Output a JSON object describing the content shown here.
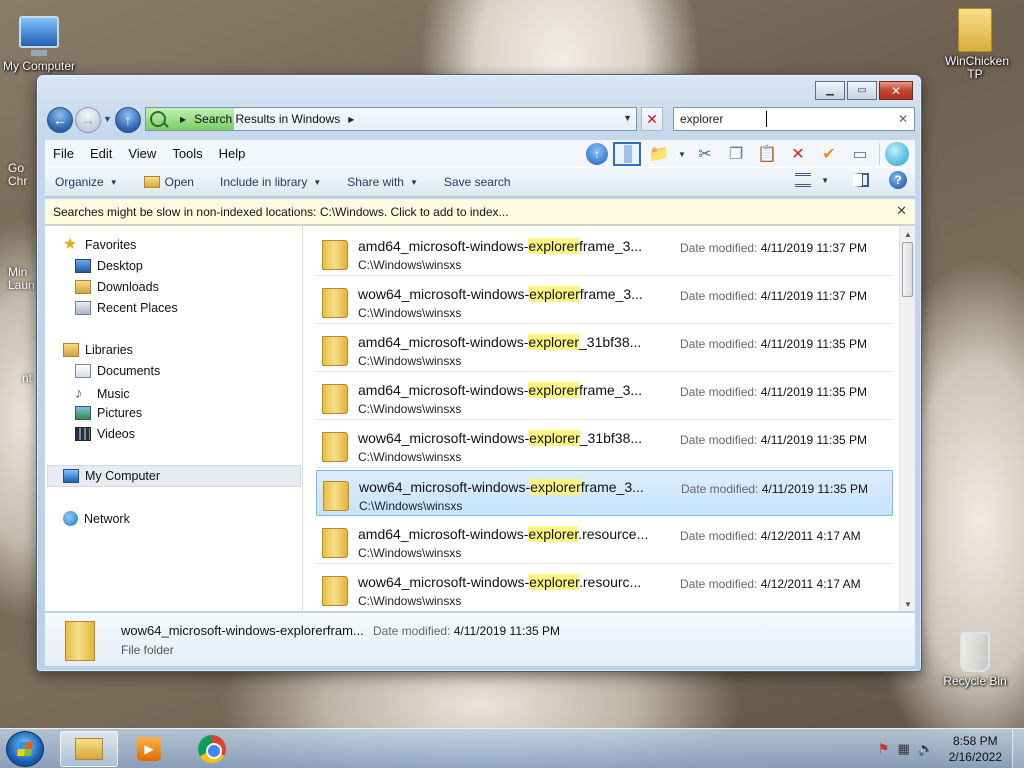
{
  "desktop": {
    "icons": {
      "my_computer": "My Computer",
      "winchicken": "WinChicken TP",
      "recycle_bin": "Recycle Bin",
      "partial_chrome": "Go\nChr",
      "partial_minecraft": "Min\nLaun",
      "partial_nt": "nt"
    }
  },
  "window": {
    "address": {
      "breadcrumb": "Search Results in Windows"
    },
    "search": {
      "value": "explorer"
    },
    "menu": [
      "File",
      "Edit",
      "View",
      "Tools",
      "Help"
    ],
    "commands": {
      "organize": "Organize",
      "open": "Open",
      "include_in_library": "Include in library",
      "share_with": "Share with",
      "save_search": "Save search"
    },
    "infobar": "Searches might be slow in non-indexed locations: C:\\Windows. Click to add to index...",
    "nav": {
      "favorites": "Favorites",
      "desktop": "Desktop",
      "downloads": "Downloads",
      "recent_places": "Recent Places",
      "libraries": "Libraries",
      "documents": "Documents",
      "music": "Music",
      "pictures": "Pictures",
      "videos": "Videos",
      "my_computer": "My Computer",
      "network": "Network"
    },
    "date_label": "Date modified:",
    "results": [
      {
        "pre": "amd64_microsoft-windows-",
        "hit": "explorer",
        "post": "frame_3...",
        "path": "C:\\Windows\\winsxs",
        "date": "4/11/2019 11:37 PM"
      },
      {
        "pre": "wow64_microsoft-windows-",
        "hit": "explorer",
        "post": "frame_3...",
        "path": "C:\\Windows\\winsxs",
        "date": "4/11/2019 11:37 PM"
      },
      {
        "pre": "amd64_microsoft-windows-",
        "hit": "explorer",
        "post": "_31bf38...",
        "path": "C:\\Windows\\winsxs",
        "date": "4/11/2019 11:35 PM"
      },
      {
        "pre": "amd64_microsoft-windows-",
        "hit": "explorer",
        "post": "frame_3...",
        "path": "C:\\Windows\\winsxs",
        "date": "4/11/2019 11:35 PM"
      },
      {
        "pre": "wow64_microsoft-windows-",
        "hit": "explorer",
        "post": "_31bf38...",
        "path": "C:\\Windows\\winsxs",
        "date": "4/11/2019 11:35 PM"
      },
      {
        "pre": "wow64_microsoft-windows-",
        "hit": "explorer",
        "post": "frame_3...",
        "path": "C:\\Windows\\winsxs",
        "date": "4/11/2019 11:35 PM"
      },
      {
        "pre": "amd64_microsoft-windows-",
        "hit": "explorer",
        "post": ".resource...",
        "path": "C:\\Windows\\winsxs",
        "date": "4/12/2011 4:17 AM"
      },
      {
        "pre": "wow64_microsoft-windows-",
        "hit": "explorer",
        "post": ".resourc...",
        "path": "C:\\Windows\\winsxs",
        "date": "4/12/2011 4:17 AM"
      }
    ],
    "selected_index": 5,
    "details": {
      "name": "wow64_microsoft-windows-explorerfram...",
      "type": "File folder",
      "date_label": "Date modified:",
      "date": "4/11/2019 11:35 PM"
    }
  },
  "taskbar": {
    "time": "8:58 PM",
    "date": "2/16/2022"
  }
}
